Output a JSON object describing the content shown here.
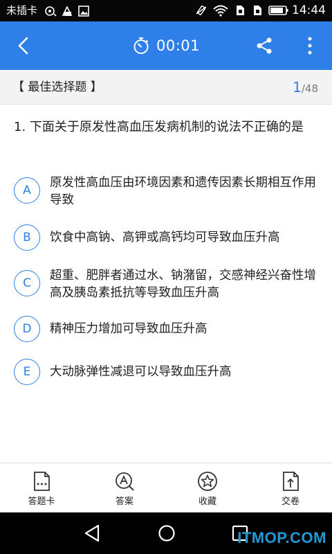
{
  "status_bar": {
    "carrier": "未插卡",
    "time": "14:44",
    "left_icons": [
      "target-icon",
      "data-saver-icon",
      "image-icon"
    ],
    "right_icons": [
      "vibrate-icon",
      "wifi-icon",
      "sim-icon",
      "sim-icon",
      "battery-icon"
    ]
  },
  "header": {
    "timer": "00:01",
    "colors": {
      "header_bg": "#2f7fe8",
      "accent": "#2f7fe8"
    }
  },
  "question_type": {
    "label": "【 最佳选择题 】",
    "current": "1",
    "separator": "/",
    "total": "48"
  },
  "question": {
    "text": "1. 下面关于原发性高血压发病机制的说法不正确的是",
    "options": [
      {
        "letter": "A",
        "text": "原发性高血压由环境因素和遗传因素长期相互作用导致"
      },
      {
        "letter": "B",
        "text": "饮食中高钠、高钾或高钙均可导致血压升高"
      },
      {
        "letter": "C",
        "text": "超重、肥胖者通过水、钠潴留，交感神经兴奋性增高及胰岛素抵抗等导致血压升高"
      },
      {
        "letter": "D",
        "text": "精神压力增加可导致血压升高"
      },
      {
        "letter": "E",
        "text": "大动脉弹性减退可以导致血压升高"
      }
    ]
  },
  "toolbar": {
    "items": [
      {
        "label": "答题卡",
        "icon": "answer-card-icon"
      },
      {
        "label": "答案",
        "icon": "answer-icon"
      },
      {
        "label": "收藏",
        "icon": "star-icon"
      },
      {
        "label": "交卷",
        "icon": "submit-icon"
      }
    ]
  },
  "watermark": "ITMOP.COM"
}
